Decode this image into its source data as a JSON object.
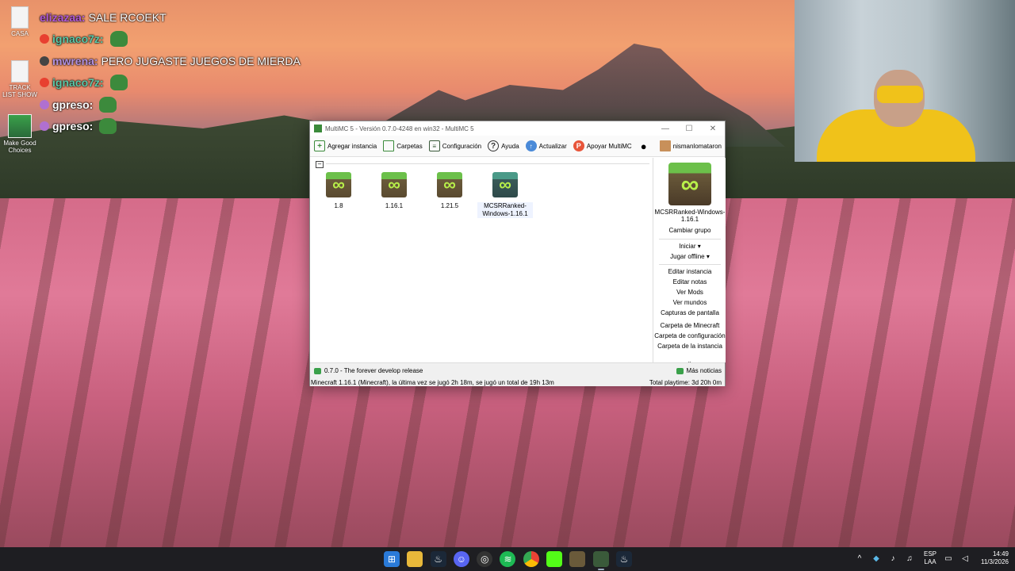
{
  "desktop": {
    "icons": [
      {
        "label": "CASA"
      },
      {
        "label": "TRACK LIST SHOW"
      },
      {
        "label": "Make Good Choices"
      }
    ]
  },
  "chat": {
    "messages": [
      {
        "user": "elizazaa:",
        "text": "SALE RCOEKT",
        "color": "#b05ad8"
      },
      {
        "user": "ignaco7z:",
        "text": "",
        "color": "#5ac8a8"
      },
      {
        "user": "mwrena:",
        "text": "PERO JUGASTE JUEGOS DE MIERDA",
        "color": "#b090e0"
      },
      {
        "user": "ignaco7z:",
        "text": "",
        "color": "#5ac8a8"
      },
      {
        "user": "gpreso:",
        "text": "",
        "color": "#ffffff"
      },
      {
        "user": "gpreso:",
        "text": "",
        "color": "#ffffff"
      }
    ]
  },
  "window": {
    "title": "MultiMC 5 - Versión 0.7.0-4248 en win32 - MultiMC 5",
    "minimize": "—",
    "maximize": "☐",
    "close": "✕",
    "toolbar": {
      "add_instance": "Agregar instancia",
      "folders": "Carpetas",
      "settings": "Configuración",
      "help": "Ayuda",
      "update": "Actualizar",
      "support": "Apoyar MultiMC",
      "account": "nismanlomataron"
    },
    "group_toggle": "–",
    "instances": [
      {
        "name": "1.8"
      },
      {
        "name": "1.16.1"
      },
      {
        "name": "1.21.5"
      },
      {
        "name": "MCSRRanked-Windows-1.16.1"
      }
    ],
    "side_panel": {
      "instance_name": "MCSRRanked-Windows-1.16.1",
      "change_group": "Cambiar grupo",
      "launch": "Iniciar ▾",
      "play_offline": "Jugar offline ▾",
      "edit_instance": "Editar instancia",
      "edit_notes": "Editar notas",
      "view_mods": "Ver Mods",
      "view_worlds": "Ver mundos",
      "screenshots": "Capturas de pantalla",
      "minecraft_folder": "Carpeta de Minecraft",
      "config_folder": "Carpeta de configuración",
      "instance_folder": "Carpeta de la instancia",
      "more": "»"
    },
    "news": "0.7.0 - The forever develop release",
    "more_news": "Más noticias",
    "status_left": "Minecraft 1.16.1 (Minecraft), la última vez se jugó 2h 18m, se jugó un total de 19h 13m",
    "status_right": "Total playtime: 3d 20h 0m"
  },
  "taskbar": {
    "lang_top": "ESP",
    "lang_bottom": "LAA",
    "time": "14:49",
    "date": "11/3/2026"
  },
  "colors": {
    "taskbar": "#1e1e22",
    "accent_green": "#3aa04a"
  }
}
